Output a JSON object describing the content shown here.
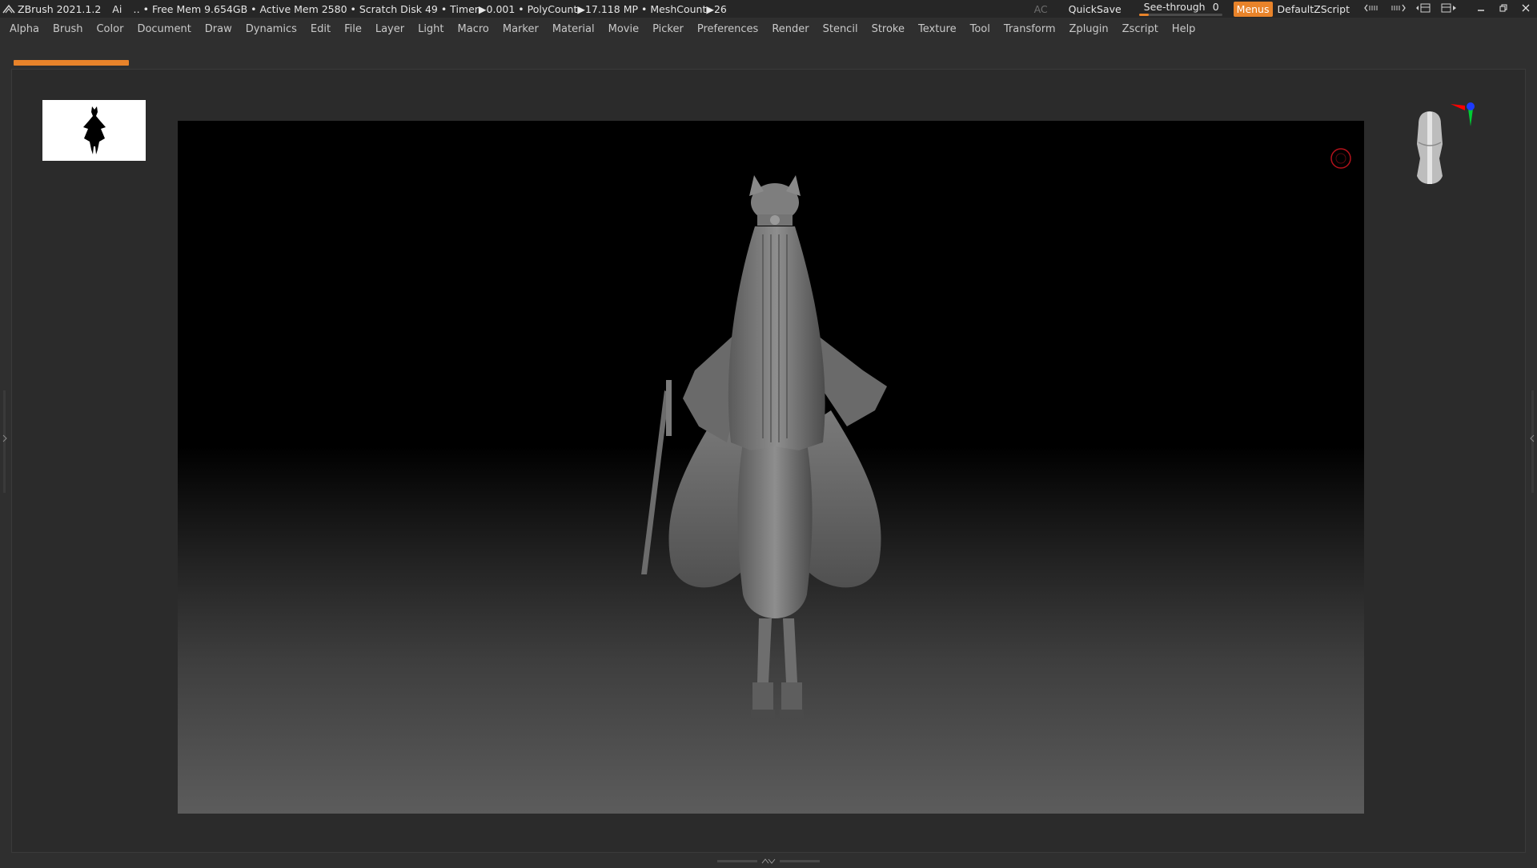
{
  "titlebar": {
    "app_name": "ZBrush 2021.1.2",
    "ai_label": "Ai",
    "stats": "‥ • Free Mem 9.654GB • Active Mem 2580 • Scratch Disk 49 •  Timer▶0.001 • PolyCount▶17.118 MP  • MeshCount▶26",
    "ac_label": "AC",
    "quicksave_label": "QuickSave",
    "seethrough_label": "See-through",
    "seethrough_value": "0",
    "menus_label": "Menus",
    "script_label": "DefaultZScript"
  },
  "menubar": {
    "items": [
      "Alpha",
      "Brush",
      "Color",
      "Document",
      "Draw",
      "Dynamics",
      "Edit",
      "File",
      "Layer",
      "Light",
      "Macro",
      "Marker",
      "Material",
      "Movie",
      "Picker",
      "Preferences",
      "Render",
      "Stencil",
      "Stroke",
      "Texture",
      "Tool",
      "Transform",
      "Zplugin",
      "Zscript",
      "Help"
    ]
  },
  "colors": {
    "accent": "#e8832a",
    "background": "#2f2f2f",
    "axis_x": "#ff0000",
    "axis_y": "#00cc33",
    "axis_z": "#1d3bff"
  },
  "icons": {
    "logo": "zbrush-logo-icon",
    "record": "record-icon",
    "minimize": "minimize-icon",
    "restore": "restore-icon",
    "close": "close-icon"
  },
  "see_through_fraction": 0.0
}
